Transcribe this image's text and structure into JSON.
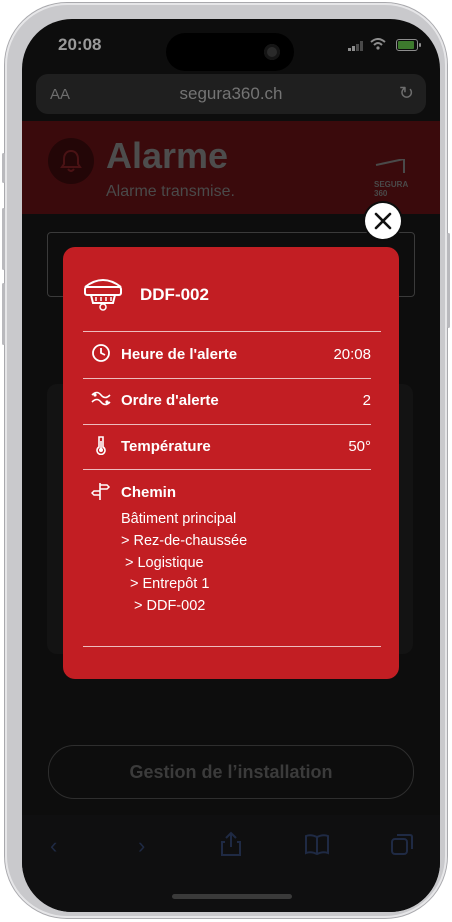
{
  "status_bar": {
    "time": "20:08"
  },
  "browser": {
    "text_size_label": "AA",
    "url": "segura360.ch"
  },
  "page": {
    "title": "Alarme",
    "subtitle": "Alarme transmise.",
    "logo_text": "SEGURA 360",
    "install_button": "Gestion de l’installation"
  },
  "modal": {
    "device_name": "DDF-002",
    "rows": [
      {
        "label": "Heure de l'alerte",
        "value": "20:08",
        "icon": "clock-icon"
      },
      {
        "label": "Ordre d'alerte",
        "value": "2",
        "icon": "sequence-icon"
      },
      {
        "label": "Température",
        "value": "50°",
        "icon": "thermometer-icon"
      }
    ],
    "path_label": "Chemin",
    "path": [
      "Bâtiment principal",
      "> Rez-de-chaussée",
      "> Logistique",
      "> Entrepôt 1",
      "> DDF-002"
    ]
  },
  "colors": {
    "modal_red": "#c21e23",
    "header_dark_red": "#3a0a0c"
  }
}
